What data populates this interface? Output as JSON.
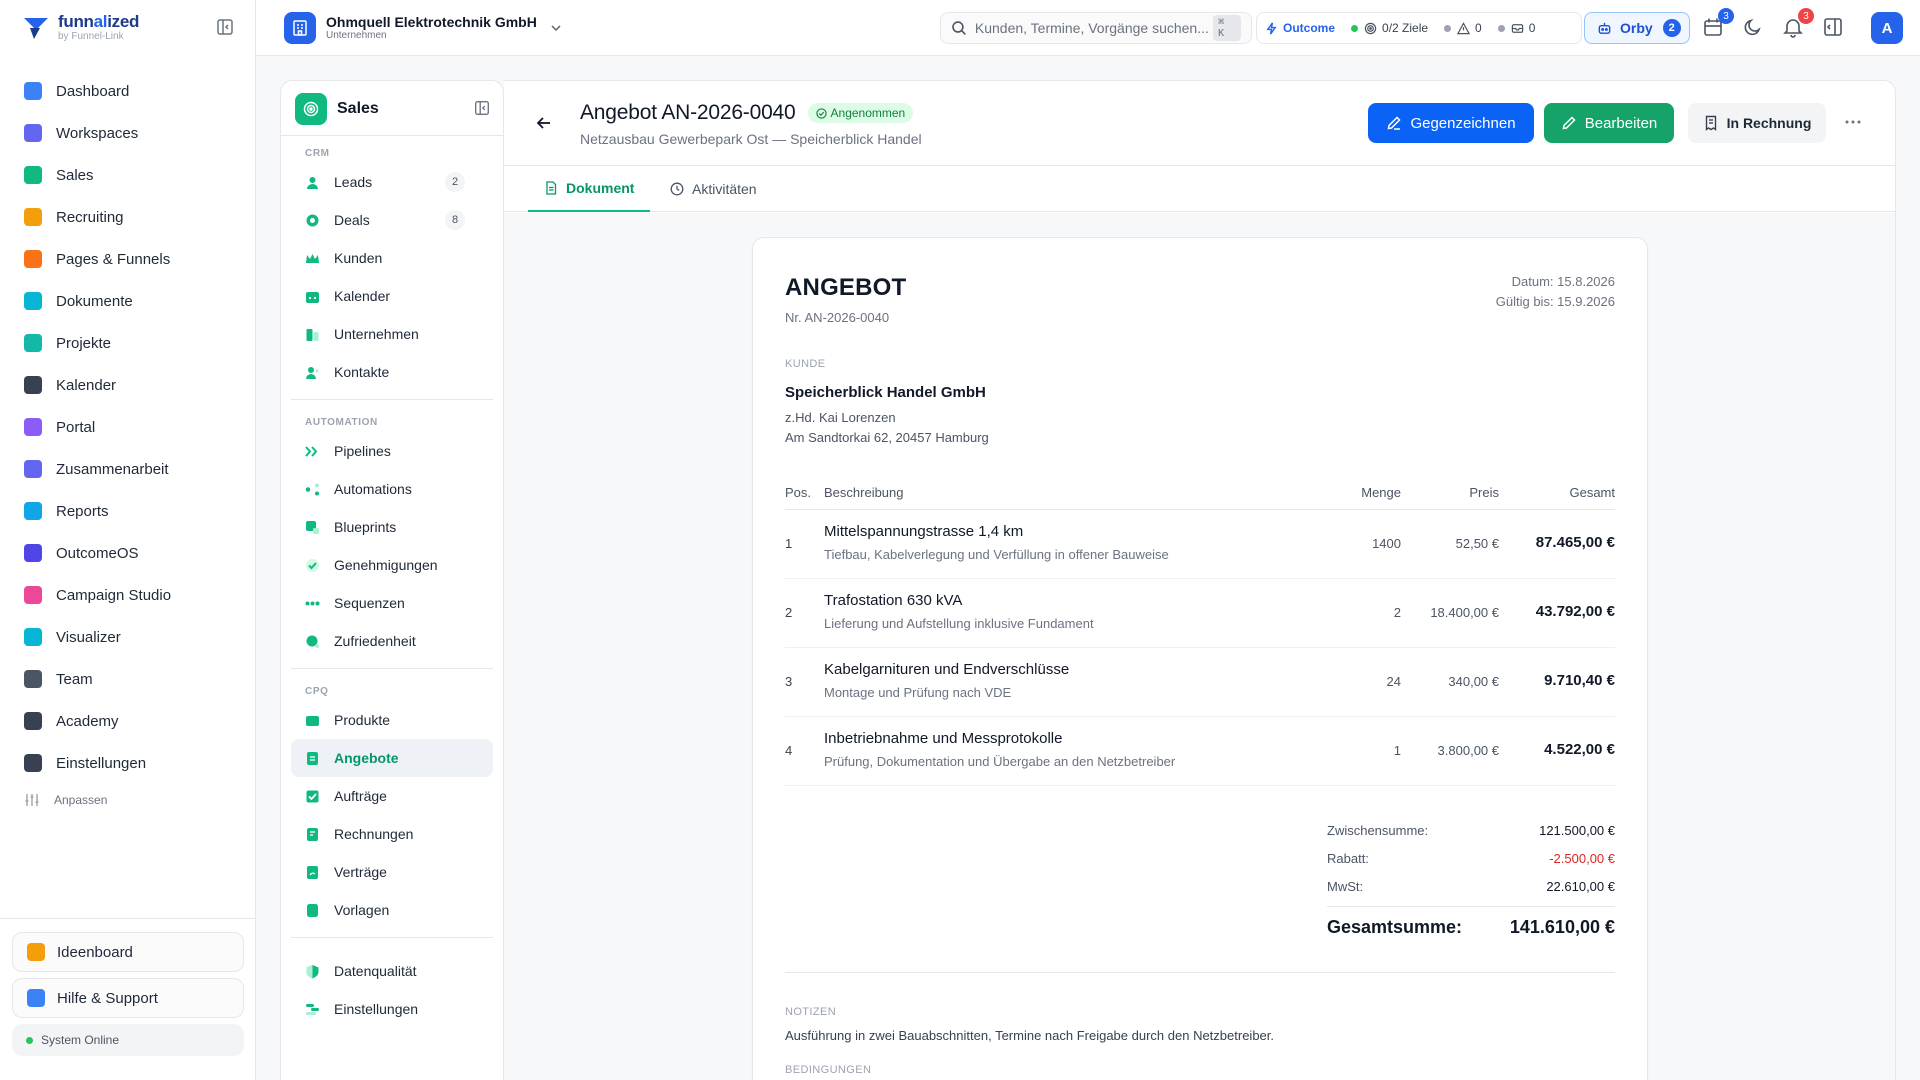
{
  "brand": {
    "name_a": "funn",
    "name_b": "al",
    "name_c": "ized",
    "sub": "by Funnel-Link"
  },
  "sidebar": {
    "items": [
      {
        "label": "Dashboard",
        "color": "#3b82f6"
      },
      {
        "label": "Workspaces",
        "color": "#6366f1"
      },
      {
        "label": "Sales",
        "color": "#10b981"
      },
      {
        "label": "Recruiting",
        "color": "#f59e0b"
      },
      {
        "label": "Pages & Funnels",
        "color": "#f97316"
      },
      {
        "label": "Dokumente",
        "color": "#06b6d4"
      },
      {
        "label": "Projekte",
        "color": "#14b8a6"
      },
      {
        "label": "Kalender",
        "color": "#374151"
      },
      {
        "label": "Portal",
        "color": "#8b5cf6"
      },
      {
        "label": "Zusammenarbeit",
        "color": "#6366f1"
      },
      {
        "label": "Reports",
        "color": "#0ea5e9"
      },
      {
        "label": "OutcomeOS",
        "color": "#4f46e5"
      },
      {
        "label": "Campaign Studio",
        "color": "#ec4899"
      },
      {
        "label": "Visualizer",
        "color": "#06b6d4"
      },
      {
        "label": "Team",
        "color": "#4b5563"
      },
      {
        "label": "Academy",
        "color": "#374151"
      },
      {
        "label": "Einstellungen",
        "color": "#374151"
      }
    ],
    "customize": "Anpassen",
    "ideaboard": "Ideenboard",
    "help": "Hilfe & Support",
    "system_status": "System Online"
  },
  "topbar": {
    "company_name": "Ohmquell Elektrotechnik GmbH",
    "company_type": "Unternehmen",
    "search_placeholder": "Kunden, Termine, Vorgänge suchen...",
    "search_kbd": "⌘ K",
    "outcome": "Outcome",
    "goals": "0/2 Ziele",
    "warnings": "0",
    "messages": "0",
    "orby": "Orby",
    "orby_count": "2",
    "calendar_count": "3",
    "notifications_count": "3",
    "avatar": "A"
  },
  "subnav": {
    "title": "Sales",
    "crm_label": "CRM",
    "crm": [
      {
        "label": "Leads",
        "count": "2"
      },
      {
        "label": "Deals",
        "count": "8"
      },
      {
        "label": "Kunden"
      },
      {
        "label": "Kalender"
      },
      {
        "label": "Unternehmen"
      },
      {
        "label": "Kontakte"
      }
    ],
    "automation_label": "AUTOMATION",
    "automation": [
      {
        "label": "Pipelines"
      },
      {
        "label": "Automations"
      },
      {
        "label": "Blueprints"
      },
      {
        "label": "Genehmigungen"
      },
      {
        "label": "Sequenzen"
      },
      {
        "label": "Zufriedenheit"
      }
    ],
    "cpq_label": "CPQ",
    "cpq": [
      {
        "label": "Produkte"
      },
      {
        "label": "Angebote"
      },
      {
        "label": "Aufträge"
      },
      {
        "label": "Rechnungen"
      },
      {
        "label": "Verträge"
      },
      {
        "label": "Vorlagen"
      }
    ],
    "extra": [
      {
        "label": "Datenqualität"
      },
      {
        "label": "Einstellungen"
      }
    ]
  },
  "header": {
    "title": "Angebot AN-2026-0040",
    "status": "Angenommen",
    "subtitle": "Netzausbau Gewerbepark Ost — Speicherblick Handel",
    "btn_countersign": "Gegenzeichnen",
    "btn_edit": "Bearbeiten",
    "btn_invoice": "In Rechnung"
  },
  "tabs": {
    "document": "Dokument",
    "activities": "Aktivitäten"
  },
  "quote": {
    "heading": "ANGEBOT",
    "number": "Nr. AN-2026-0040",
    "date": "Datum: 15.8.2026",
    "valid_until": "Gültig bis: 15.9.2026",
    "customer_label": "KUNDE",
    "customer_name": "Speicherblick Handel GmbH",
    "customer_attn": "z.Hd. Kai Lorenzen",
    "customer_address": "Am Sandtorkai 62, 20457 Hamburg",
    "columns": {
      "pos": "Pos.",
      "desc": "Beschreibung",
      "qty": "Menge",
      "price": "Preis",
      "total": "Gesamt"
    },
    "items": [
      {
        "pos": "1",
        "title": "Mittelspannungstrasse 1,4 km",
        "sub": "Tiefbau, Kabelverlegung und Verfüllung in offener Bauweise",
        "qty": "1400",
        "price": "52,50 €",
        "total": "87.465,00 €"
      },
      {
        "pos": "2",
        "title": "Trafostation 630 kVA",
        "sub": "Lieferung und Aufstellung inklusive Fundament",
        "qty": "2",
        "price": "18.400,00 €",
        "total": "43.792,00 €"
      },
      {
        "pos": "3",
        "title": "Kabelgarnituren und Endverschlüsse",
        "sub": "Montage und Prüfung nach VDE",
        "qty": "24",
        "price": "340,00 €",
        "total": "9.710,40 €"
      },
      {
        "pos": "4",
        "title": "Inbetriebnahme und Messprotokolle",
        "sub": "Prüfung, Dokumentation und Übergabe an den Netzbetreiber",
        "qty": "1",
        "price": "3.800,00 €",
        "total": "4.522,00 €"
      }
    ],
    "subtotal_label": "Zwischensumme:",
    "subtotal": "121.500,00 €",
    "discount_label": "Rabatt:",
    "discount": "-2.500,00 €",
    "vat_label": "MwSt:",
    "vat": "22.610,00 €",
    "grand_label": "Gesamtsumme:",
    "grand_total": "141.610,00 €",
    "notes_label": "NOTIZEN",
    "notes": "Ausführung in zwei Bauabschnitten, Termine nach Freigabe durch den Netzbetreiber.",
    "terms_label": "BEDINGUNGEN"
  }
}
